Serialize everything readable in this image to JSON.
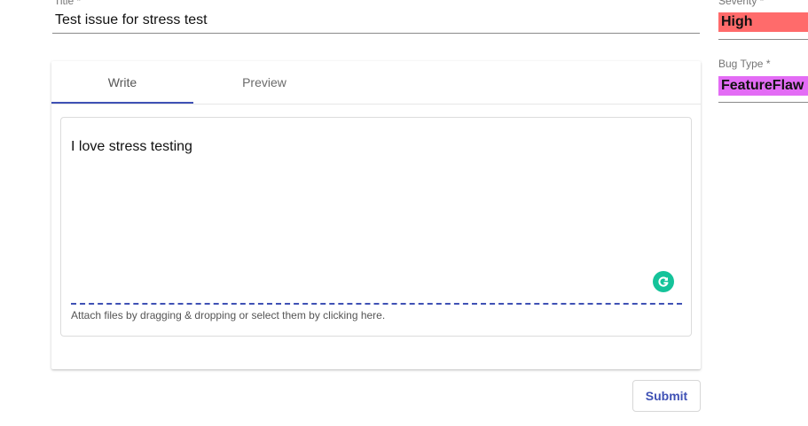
{
  "title_field": {
    "label": "Title *",
    "value": "Test issue for stress test"
  },
  "editor": {
    "tabs": [
      {
        "label": "Write",
        "active": true
      },
      {
        "label": "Preview",
        "active": false
      }
    ],
    "body_text": "I love stress testing",
    "attach_hint": "Attach files by dragging & dropping or select them by clicking here.",
    "grammarly_icon": "grammarly-icon",
    "accent_color": "#3f51b5"
  },
  "submit": {
    "label": "Submit"
  },
  "severity": {
    "label": "Severity *",
    "value": "High",
    "color": "#ff6b6b"
  },
  "bug_type": {
    "label": "Bug Type *",
    "value": "FeatureFlaw",
    "color": "#e36cf5"
  }
}
